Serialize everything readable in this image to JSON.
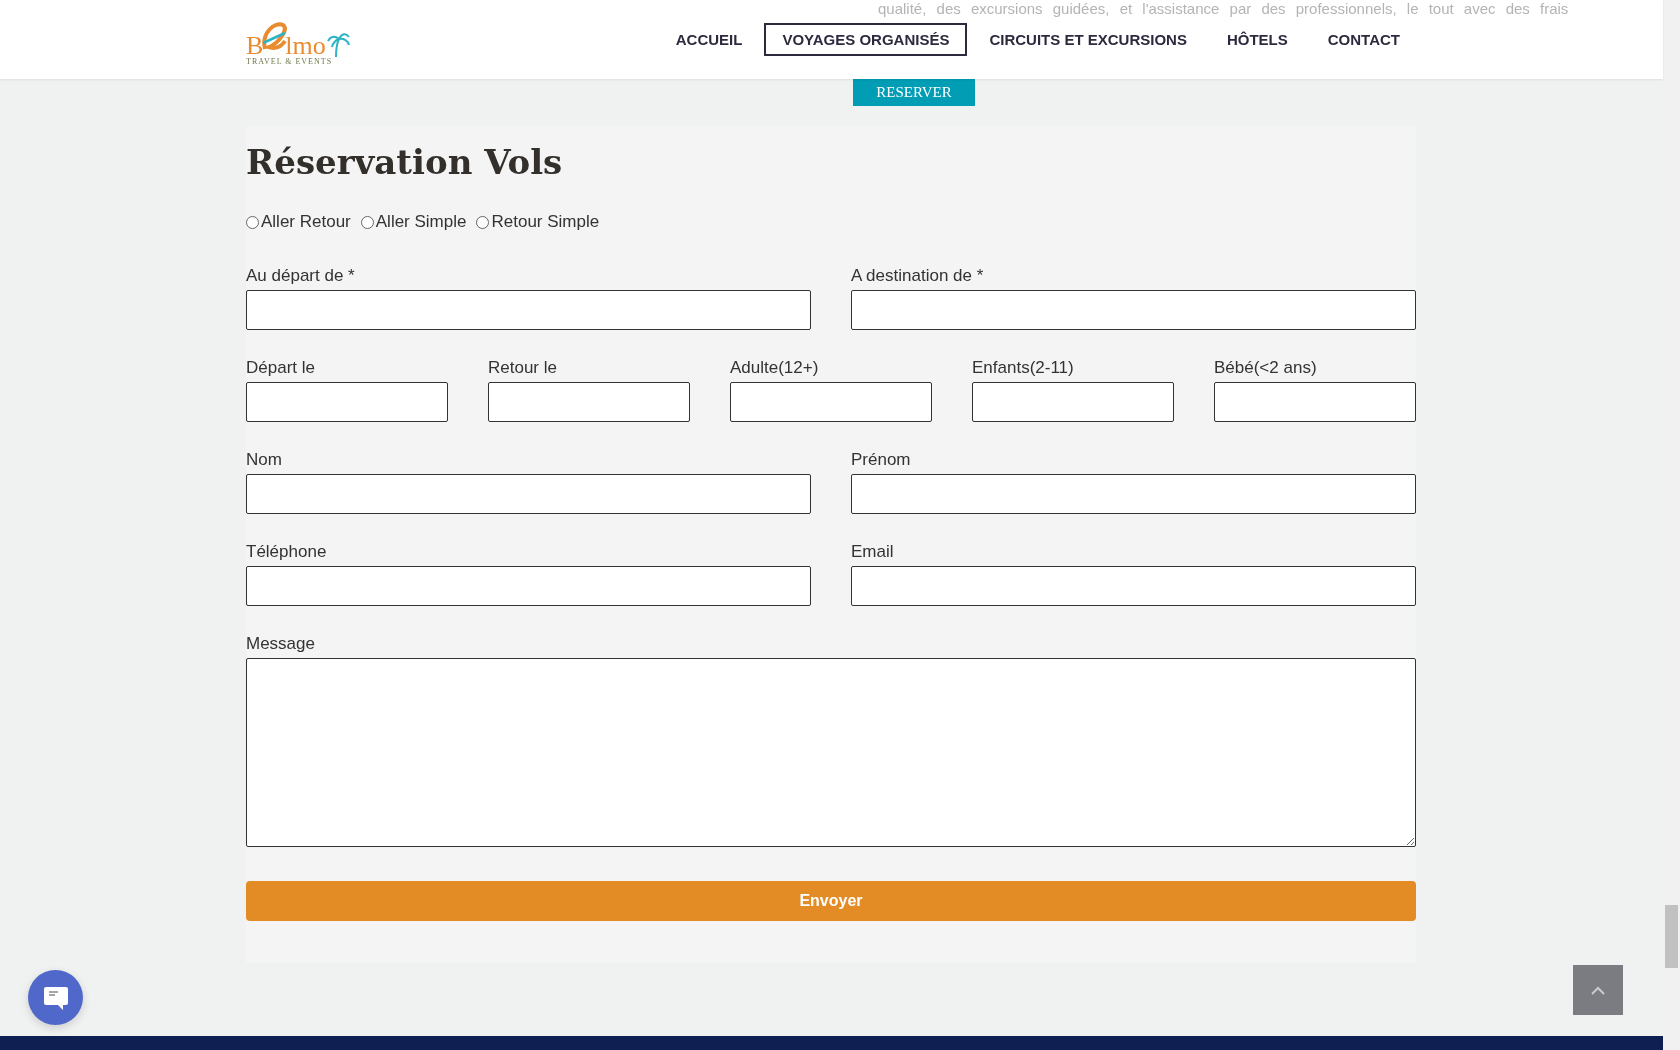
{
  "header": {
    "logo": {
      "letter_1": "B",
      "letters": "lmo",
      "tagline": "TRAVEL & EVENTS"
    },
    "background_text": "qualité, des excursions guidées, et l'assistance par des professionnels, le tout avec des frais",
    "nav": [
      {
        "label": "ACCUEIL",
        "selected": false
      },
      {
        "label": "VOYAGES ORGANISÉS",
        "selected": true
      },
      {
        "label": "CIRCUITS ET EXCURSIONS",
        "selected": false
      },
      {
        "label": "HÔTELS",
        "selected": false
      },
      {
        "label": "CONTACT",
        "selected": false
      }
    ]
  },
  "reserve_button": "RESERVER",
  "form": {
    "title": "Réservation Vols",
    "trip_types": [
      {
        "label": "Aller Retour",
        "selected": false
      },
      {
        "label": "Aller Simple",
        "selected": false
      },
      {
        "label": "Retour Simple",
        "selected": false
      }
    ],
    "rows": [
      [
        {
          "label": "Au départ de *"
        },
        {
          "label": "A destination de *"
        }
      ],
      [
        {
          "label": "Départ le"
        },
        {
          "label": "Retour le"
        },
        {
          "label": "Adulte(12+)"
        },
        {
          "label": "Enfants(2-11)"
        },
        {
          "label": "Bébé(<2 ans)"
        }
      ],
      [
        {
          "label": "Nom"
        },
        {
          "label": "Prénom"
        }
      ],
      [
        {
          "label": "Téléphone"
        },
        {
          "label": "Email"
        }
      ]
    ],
    "message_label": "Message",
    "submit": "Envoyer"
  }
}
